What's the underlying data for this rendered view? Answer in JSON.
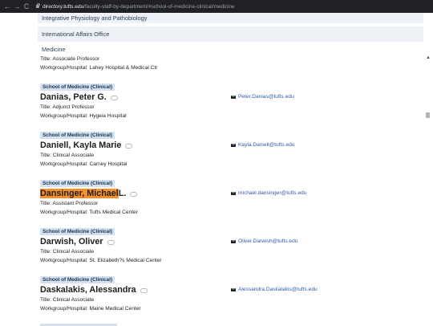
{
  "browser": {
    "url_host": "directory.tufts.edu",
    "url_path": "/faculty-staff-by-department/#school-of-medicine-clinical/medicine",
    "back_glyph": "←",
    "forward_glyph": "→",
    "reload_glyph": "C"
  },
  "accordions": [
    {
      "label": "Integrative Physiology and Pathobiology",
      "expanded": false,
      "chevron": "⌄"
    },
    {
      "label": "International Affairs Office",
      "expanded": false,
      "chevron": "⌄"
    },
    {
      "label": "Medicine",
      "expanded": true,
      "chevron": "⌃"
    }
  ],
  "top_partial": {
    "title": "Title: Associate Professor",
    "workgroup": "Workgroup/Hospital: Lahey Hospital & Medical Ctr"
  },
  "people": [
    {
      "badge": "School of Medicine (Clinical)",
      "name": "Danias, Peter G.",
      "title": "Title: Adjunct Professor",
      "workgroup": "Workgroup/Hospital: Hygeia Hospital",
      "email": "Peter.Danias@tufts.edu"
    },
    {
      "badge": "School of Medicine (Clinical)",
      "name": "Daniell, Kayla Marie",
      "title": "Title: Clinical Associate",
      "workgroup": "Workgroup/Hospital: Carney Hospital",
      "email": "Kayla.Daniell@tufts.edu"
    },
    {
      "badge": "School of Medicine (Clinical)",
      "name_highlight": "Dansinger, Michael",
      "name_rest": " L.",
      "title": "Title: Assistant Professor",
      "workgroup": "Workgroup/Hospital: Tufts Medical Center",
      "email": "michael.dansinger@tufts.edu"
    },
    {
      "badge": "School of Medicine (Clinical)",
      "name": "Darwish, Oliver",
      "title": "Title: Clinical Associate",
      "workgroup": "Workgroup/Hospital: St. Elizabeth?s Medical Center",
      "email": "Oliver.Darwish@tufts.edu"
    },
    {
      "badge": "School of Medicine (Clinical)",
      "name": "Daskalakis, Alessandra",
      "title": "Title: Clinical Associate",
      "workgroup": "Workgroup/Hospital: Maine Medical Center",
      "email": "Alessandra.Daskalakis@tufts.edu"
    }
  ],
  "colors": {
    "highlight": "#f7902b",
    "badge_bg": "#d5e1f0",
    "link": "#2f5ba8"
  },
  "icons": {
    "lock": "lock-icon",
    "link": "link-icon",
    "mail": "envelope-icon"
  }
}
